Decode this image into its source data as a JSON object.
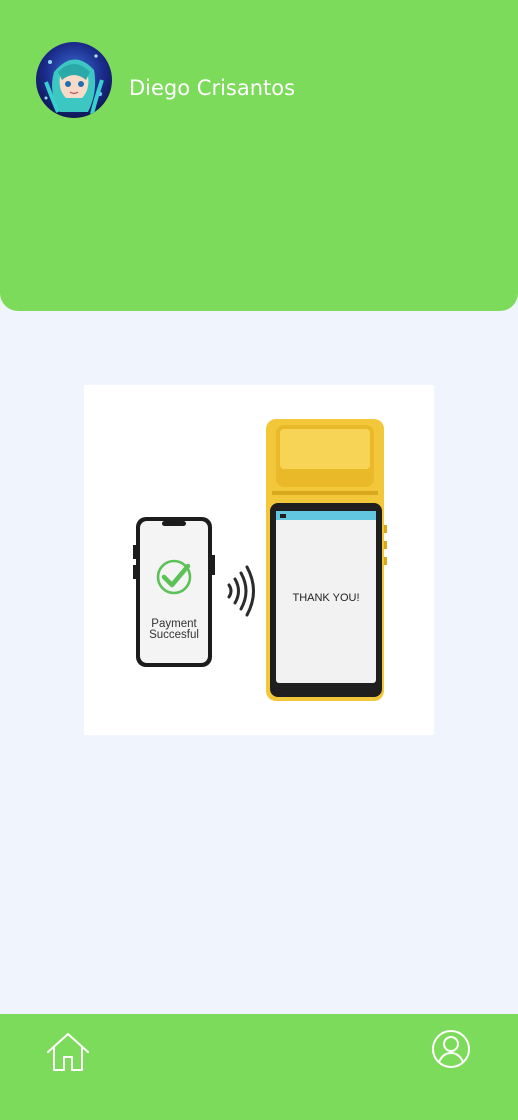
{
  "header": {
    "user_name": "Diego Crisantos",
    "background_color": "#7ddb5b"
  },
  "avatar": {
    "icon": "avatar-anime-character"
  },
  "illustration": {
    "phone_text_line1": "Payment",
    "phone_text_line2": "Succesful",
    "terminal_text": "THANK YOU!",
    "check_color": "#5cc157",
    "terminal_color": "#f2c83a"
  },
  "bottom_nav": {
    "home_icon": "home-icon",
    "profile_icon": "user-circle-icon",
    "background_color": "#7ddb5b"
  }
}
